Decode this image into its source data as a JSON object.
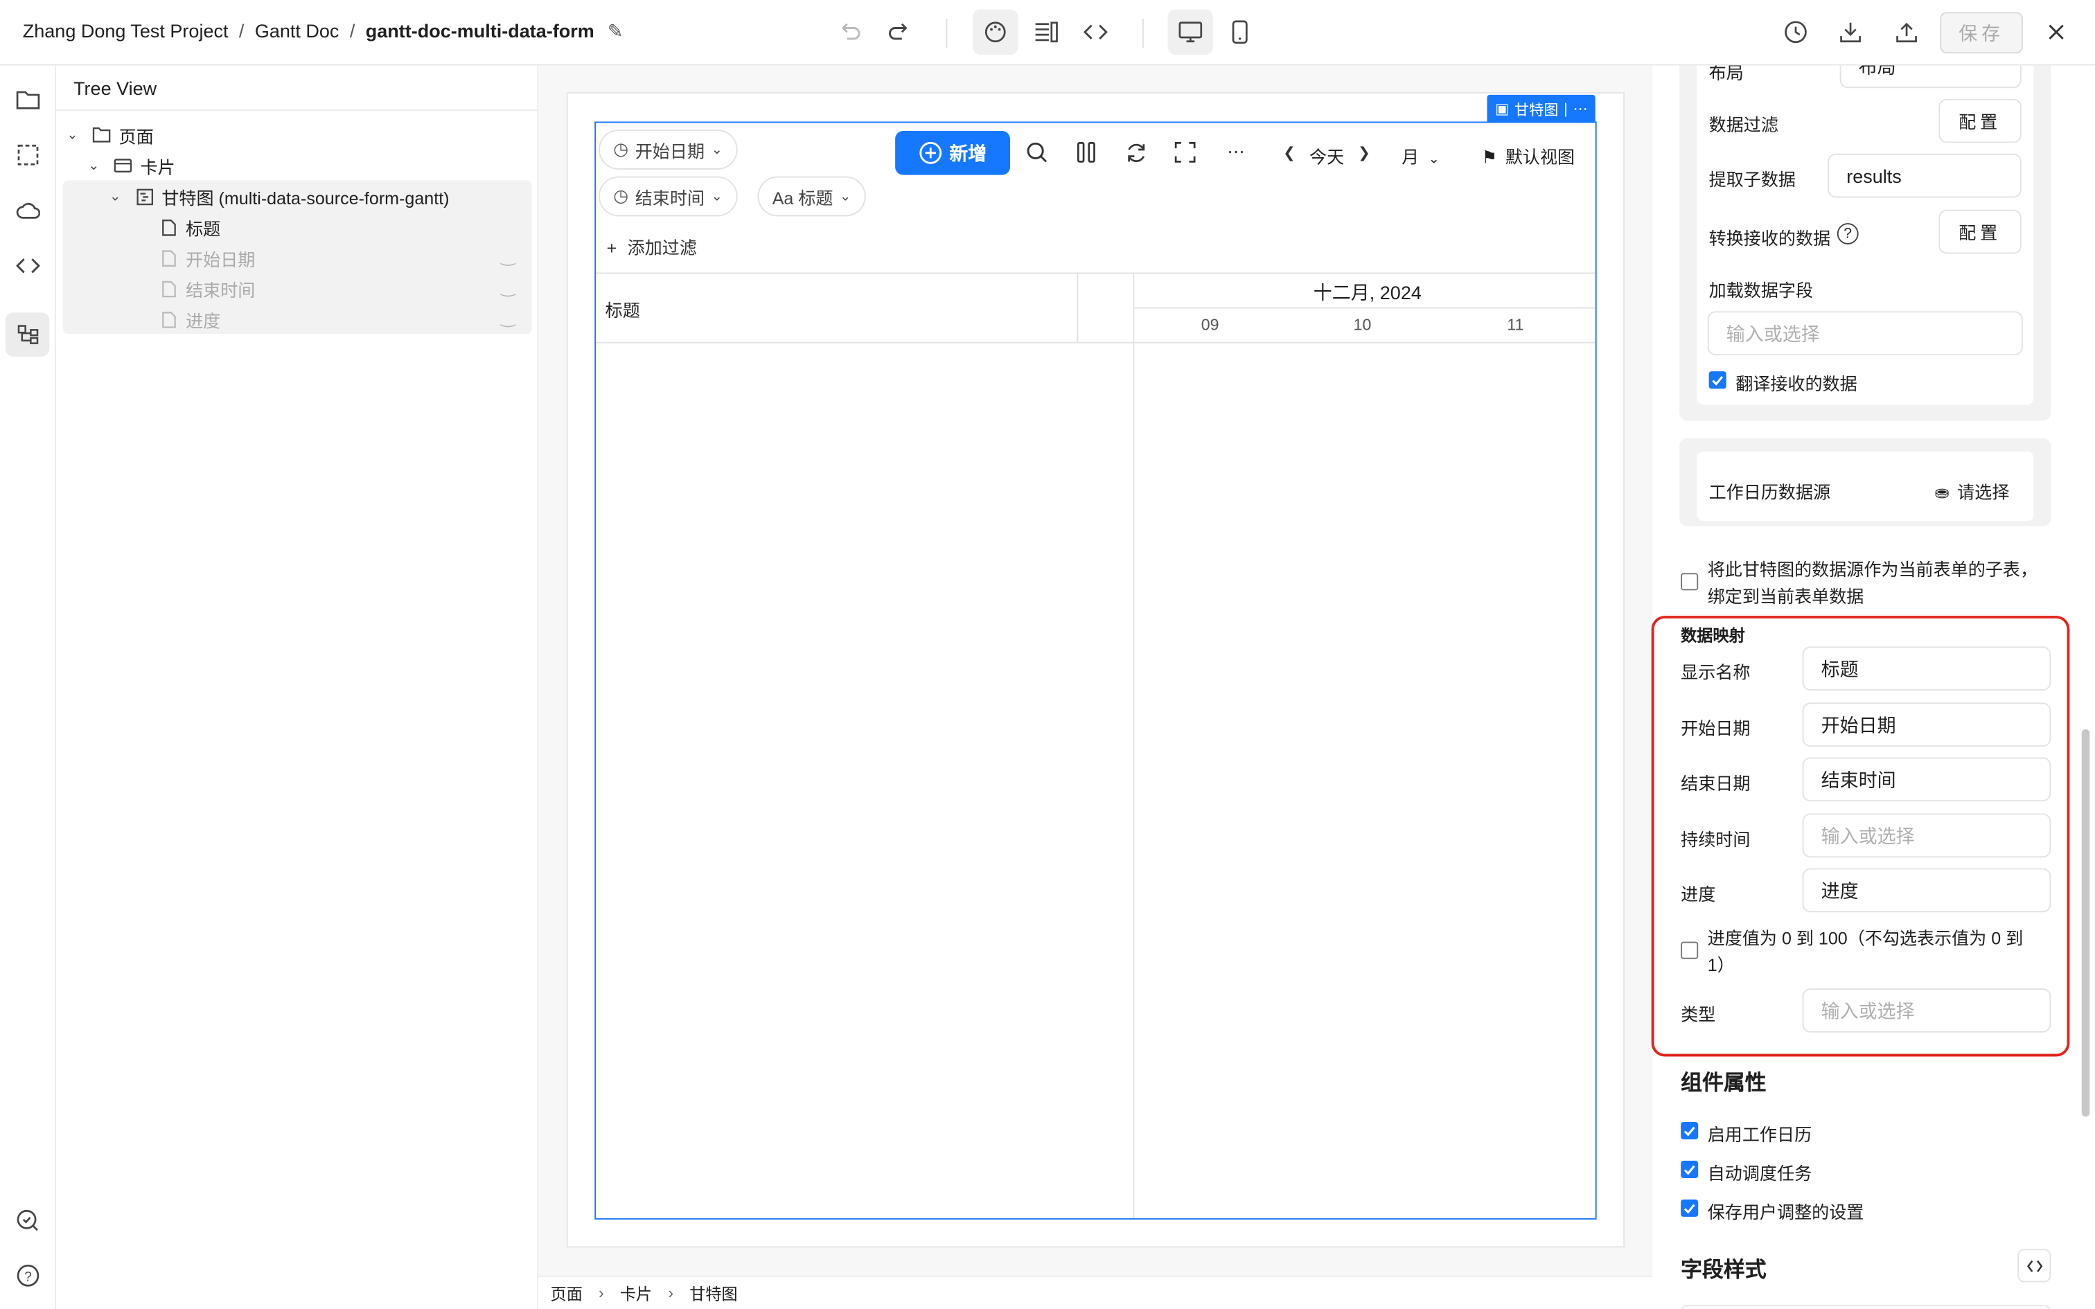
{
  "breadcrumb": {
    "project": "Zhang Dong Test Project",
    "sep": "/",
    "doc": "Gantt Doc",
    "page": "gantt-doc-multi-data-form"
  },
  "toolbar": {
    "save_label": "保存"
  },
  "tree": {
    "title": "Tree View",
    "nodes": [
      {
        "label": "页面"
      },
      {
        "label": "卡片"
      },
      {
        "label": "甘特图 (multi-data-source-form-gantt)"
      },
      {
        "label": "标题"
      },
      {
        "label": "开始日期"
      },
      {
        "label": "结束时间"
      },
      {
        "label": "进度"
      }
    ]
  },
  "gantt": {
    "badge": "甘特图",
    "filters": [
      "开始日期",
      "结束时间",
      "Aa 标题"
    ],
    "add_label": "新增",
    "today_label": "今天",
    "month_label": "月",
    "default_view": "默认视图",
    "add_filter": "添加过滤",
    "column_title": "标题",
    "month_header": "十二月, 2024",
    "days": [
      "09",
      "10",
      "11"
    ]
  },
  "footer_crumbs": [
    "页面",
    "卡片",
    "甘特图"
  ],
  "panel": {
    "partial_label": "布局",
    "partial_value": "布局",
    "data_filter": "数据过滤",
    "config_label": "配置",
    "extract": "提取子数据",
    "extract_value": "results",
    "transform": "转换接收的数据",
    "load_field": "加载数据字段",
    "placeholder": "输入或选择",
    "translate": "翻译接收的数据",
    "calendar_source": "工作日历数据源",
    "calendar_value": "请选择",
    "subtable_text": "将此甘特图的数据源作为当前表单的子表，绑定到当前表单数据",
    "mapping_title": "数据映射",
    "mapping": [
      {
        "label": "显示名称",
        "value": "标题"
      },
      {
        "label": "开始日期",
        "value": "开始日期"
      },
      {
        "label": "结束日期",
        "value": "结束时间"
      },
      {
        "label": "持续时间",
        "value": ""
      },
      {
        "label": "进度",
        "value": "进度"
      }
    ],
    "progress_note": "进度值为 0 到 100（不勾选表示值为 0 到 1）",
    "type_label": "类型",
    "component_title": "组件属性",
    "checkboxes": [
      "启用工作日历",
      "自动调度任务",
      "保存用户调整的设置"
    ],
    "field_style": "字段样式"
  },
  "colors": {
    "accent": "#1677ff",
    "highlight": "#e0261c"
  }
}
